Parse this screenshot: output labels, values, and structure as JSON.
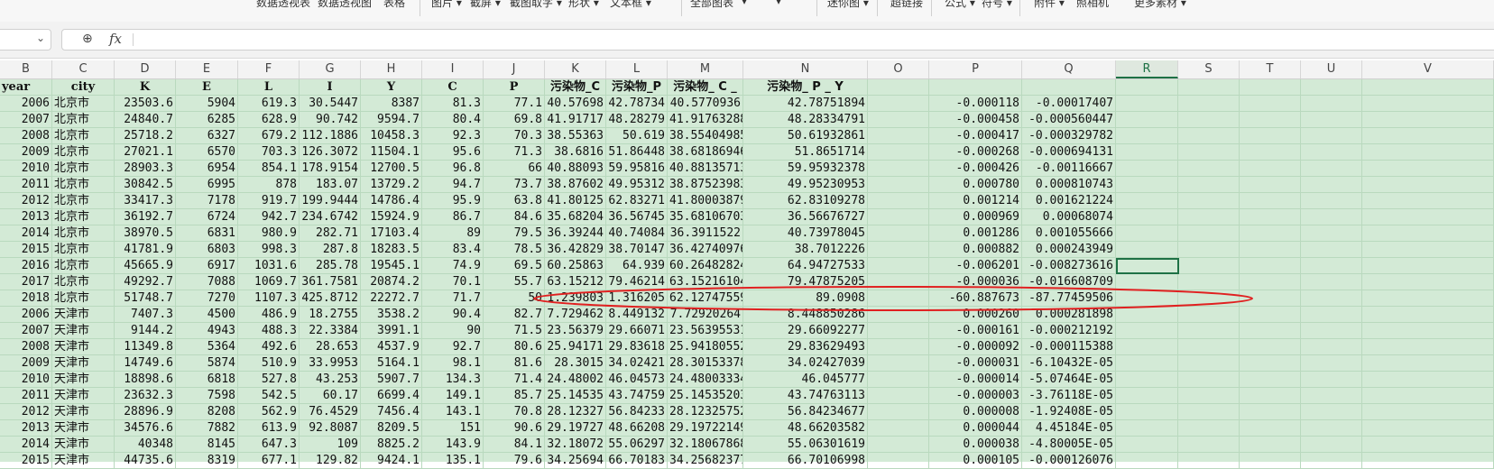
{
  "ribbon": [
    "数据透视表",
    "数据透视图",
    "表格",
    "图片 ▾",
    "截屏 ▾",
    "截图取字 ▾",
    "形状 ▾",
    "文本框 ▾",
    "全部图表",
    "▾",
    "▾",
    "迷你图 ▾",
    "超链接",
    "公式 ▾",
    "符号 ▾",
    "附件 ▾",
    "照相机",
    "更多素材 ▾"
  ],
  "formula_bar": {
    "name_box": "",
    "fx_label": "fx",
    "formula": ""
  },
  "columns": [
    "B",
    "C",
    "D",
    "E",
    "F",
    "G",
    "H",
    "I",
    "J",
    "K",
    "L",
    "M",
    "N",
    "O",
    "P",
    "Q",
    "R",
    "S",
    "T",
    "U",
    "V"
  ],
  "selected_column": "R",
  "headers": [
    "year",
    "city",
    "K",
    "E",
    "L",
    "I",
    "Y",
    "C",
    "P",
    "污染物_C",
    "污染物_P",
    "污染物_ C _",
    "污染物_ P _ Y",
    "",
    "",
    "",
    "",
    "",
    "",
    "",
    ""
  ],
  "rows": [
    [
      "2006",
      "北京市",
      "23503.6",
      "5904",
      "619.3",
      "30.5447",
      "8387",
      "81.3",
      "77.1",
      "40.57698",
      "42.78734",
      "40.5770936",
      "42.78751894",
      "",
      "-0.000118",
      "-0.00017407",
      "",
      "",
      "",
      "",
      ""
    ],
    [
      "2007",
      "北京市",
      "24840.7",
      "6285",
      "628.9",
      "90.742",
      "9594.7",
      "80.4",
      "69.8",
      "41.91717",
      "48.28279",
      "41.91763288",
      "48.28334791",
      "",
      "-0.000458",
      "-0.000560447",
      "",
      "",
      "",
      "",
      ""
    ],
    [
      "2008",
      "北京市",
      "25718.2",
      "6327",
      "679.2",
      "112.1886",
      "10458.3",
      "92.3",
      "70.3",
      "38.55363",
      "50.619",
      "38.55404985",
      "50.61932861",
      "",
      "-0.000417",
      "-0.000329782",
      "",
      "",
      "",
      "",
      ""
    ],
    [
      "2009",
      "北京市",
      "27021.1",
      "6570",
      "703.3",
      "126.3072",
      "11504.1",
      "95.6",
      "71.3",
      "38.6816",
      "51.86448",
      "38.68186946",
      "51.8651714",
      "",
      "-0.000268",
      "-0.000694131",
      "",
      "",
      "",
      "",
      ""
    ],
    [
      "2010",
      "北京市",
      "28903.3",
      "6954",
      "854.1",
      "178.9154",
      "12700.5",
      "96.8",
      "66",
      "40.88093",
      "59.95816",
      "40.88135713",
      "59.95932378",
      "",
      "-0.000426",
      "-0.00116667",
      "",
      "",
      "",
      "",
      ""
    ],
    [
      "2011",
      "北京市",
      "30842.5",
      "6995",
      "878",
      "183.07",
      "13729.2",
      "94.7",
      "73.7",
      "38.87602",
      "49.95312",
      "38.87523983",
      "49.95230953",
      "",
      "0.000780",
      "0.000810743",
      "",
      "",
      "",
      "",
      ""
    ],
    [
      "2012",
      "北京市",
      "33417.3",
      "7178",
      "919.7",
      "199.9444",
      "14786.4",
      "95.9",
      "63.8",
      "41.80125",
      "62.83271",
      "41.80003879",
      "62.83109278",
      "",
      "0.001214",
      "0.001621224",
      "",
      "",
      "",
      "",
      ""
    ],
    [
      "2013",
      "北京市",
      "36192.7",
      "6724",
      "942.7",
      "234.6742",
      "15924.9",
      "86.7",
      "84.6",
      "35.68204",
      "36.56745",
      "35.68106703",
      "36.56676727",
      "",
      "0.000969",
      "0.00068074",
      "",
      "",
      "",
      "",
      ""
    ],
    [
      "2014",
      "北京市",
      "38970.5",
      "6831",
      "980.9",
      "282.71",
      "17103.4",
      "89",
      "79.5",
      "36.39244",
      "40.74084",
      "36.3911522",
      "40.73978045",
      "",
      "0.001286",
      "0.001055666",
      "",
      "",
      "",
      "",
      ""
    ],
    [
      "2015",
      "北京市",
      "41781.9",
      "6803",
      "998.3",
      "287.8",
      "18283.5",
      "83.4",
      "78.5",
      "36.42829",
      "38.70147",
      "36.42740976",
      "38.7012226",
      "",
      "0.000882",
      "0.000243949",
      "",
      "",
      "",
      "",
      ""
    ],
    [
      "2016",
      "北京市",
      "45665.9",
      "6917",
      "1031.6",
      "285.78",
      "19545.1",
      "74.9",
      "69.5",
      "60.25863",
      "64.939",
      "60.26482824",
      "64.94727533",
      "",
      "-0.006201",
      "-0.008273616",
      "",
      "",
      "",
      "",
      ""
    ],
    [
      "2017",
      "北京市",
      "49292.7",
      "7088",
      "1069.7",
      "361.7581",
      "20874.2",
      "70.1",
      "55.7",
      "63.15212",
      "79.46214",
      "63.15216104",
      "79.47875205",
      "",
      "-0.000036",
      "-0.016608709",
      "",
      "",
      "",
      "",
      ""
    ],
    [
      "2018",
      "北京市",
      "51748.7",
      "7270",
      "1107.3",
      "425.8712",
      "22272.7",
      "71.7",
      "50",
      "1.239803",
      "1.316205",
      "62.12747559",
      "89.0908",
      "",
      "-60.887673",
      "-87.77459506",
      "",
      "",
      "",
      "",
      ""
    ],
    [
      "2006",
      "天津市",
      "7407.3",
      "4500",
      "486.9",
      "18.2755",
      "3538.2",
      "90.4",
      "82.7",
      "7.729462",
      "8.449132",
      "7.72920264",
      "8.448850286",
      "",
      "0.000260",
      "0.000281898",
      "",
      "",
      "",
      "",
      ""
    ],
    [
      "2007",
      "天津市",
      "9144.2",
      "4943",
      "488.3",
      "22.3384",
      "3991.1",
      "90",
      "71.5",
      "23.56379",
      "29.66071",
      "23.56395531",
      "29.66092277",
      "",
      "-0.000161",
      "-0.000212192",
      "",
      "",
      "",
      "",
      ""
    ],
    [
      "2008",
      "天津市",
      "11349.8",
      "5364",
      "492.6",
      "28.653",
      "4537.9",
      "92.7",
      "80.6",
      "25.94171",
      "29.83618",
      "25.94180552",
      "29.83629493",
      "",
      "-0.000092",
      "-0.000115388",
      "",
      "",
      "",
      "",
      ""
    ],
    [
      "2009",
      "天津市",
      "14749.6",
      "5874",
      "510.9",
      "33.9953",
      "5164.1",
      "98.1",
      "81.6",
      "28.3015",
      "34.02421",
      "28.30153378",
      "34.02427039",
      "",
      "-0.000031",
      "-6.10432E-05",
      "",
      "",
      "",
      "",
      ""
    ],
    [
      "2010",
      "天津市",
      "18898.6",
      "6818",
      "527.8",
      "43.253",
      "5907.7",
      "134.3",
      "71.4",
      "24.48002",
      "46.04573",
      "24.48003334",
      "46.045777",
      "",
      "-0.000014",
      "-5.07464E-05",
      "",
      "",
      "",
      "",
      ""
    ],
    [
      "2011",
      "天津市",
      "23632.3",
      "7598",
      "542.5",
      "60.17",
      "6699.4",
      "149.1",
      "85.7",
      "25.14535",
      "43.74759",
      "25.14535203",
      "43.74763113",
      "",
      "-0.000003",
      "-3.76118E-05",
      "",
      "",
      "",
      "",
      ""
    ],
    [
      "2012",
      "天津市",
      "28896.9",
      "8208",
      "562.9",
      "76.4529",
      "7456.4",
      "143.1",
      "70.8",
      "28.12327",
      "56.84233",
      "28.12325752",
      "56.84234677",
      "",
      "0.000008",
      "-1.92408E-05",
      "",
      "",
      "",
      "",
      ""
    ],
    [
      "2013",
      "天津市",
      "34576.6",
      "7882",
      "613.9",
      "92.8087",
      "8209.5",
      "151",
      "90.6",
      "29.19727",
      "48.66208",
      "29.19722149",
      "48.66203582",
      "",
      "0.000044",
      "4.45184E-05",
      "",
      "",
      "",
      "",
      ""
    ],
    [
      "2014",
      "天津市",
      "40348",
      "8145",
      "647.3",
      "109",
      "8825.2",
      "143.9",
      "84.1",
      "32.18072",
      "55.06297",
      "32.18067868",
      "55.06301619",
      "",
      "0.000038",
      "-4.80005E-05",
      "",
      "",
      "",
      "",
      ""
    ],
    [
      "2015",
      "天津市",
      "44735.6",
      "8319",
      "677.1",
      "129.82",
      "9424.1",
      "135.1",
      "79.6",
      "34.25694",
      "66.70183",
      "34.25682377",
      "66.70106998",
      "",
      "0.000105",
      "-0.000126076",
      "",
      "",
      "",
      "",
      ""
    ]
  ],
  "annotation": {
    "color": "#e02020",
    "target_row": "2018 北京市"
  }
}
